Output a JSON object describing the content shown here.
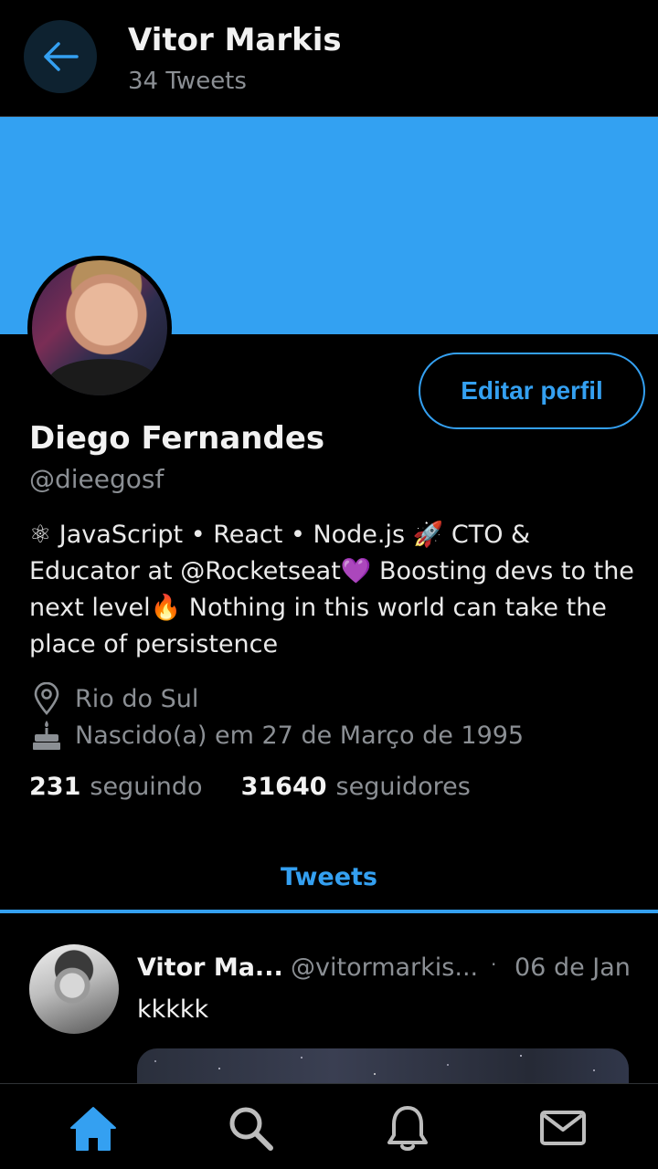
{
  "header": {
    "title": "Vitor Markis",
    "subtitle": "34 Tweets",
    "back_icon": "arrow-left-icon"
  },
  "profile": {
    "banner_color": "#33a1f2",
    "name": "Diego Fernandes",
    "handle": "@dieegosf",
    "edit_button": "Editar perfil",
    "bio_lines": [
      "⚛ JavaScript • React • Node.js 🚀 CTO &",
      "Educator at @Rocketseat💜 Boosting devs to the",
      "next level🔥 Nothing in this world can take the",
      "place of persistence"
    ],
    "location": "Rio do Sul",
    "birthday": "Nascido(a) em 27 de Março de 1995",
    "following_count": "231",
    "following_label": "seguindo",
    "followers_count": "31640",
    "followers_label": "seguidores"
  },
  "tabs": {
    "active": "Tweets"
  },
  "tweet": {
    "author": "Vitor Ma...",
    "handle": "@vitormarkis...",
    "separator": "·",
    "date": "06 de Jan",
    "text": "kkkkk"
  },
  "nav": {
    "items": [
      "home-icon",
      "search-icon",
      "bell-icon",
      "mail-icon"
    ],
    "active": "home-icon"
  },
  "colors": {
    "accent": "#34a0f1",
    "background": "#000000",
    "muted_text": "#8b8f94"
  }
}
